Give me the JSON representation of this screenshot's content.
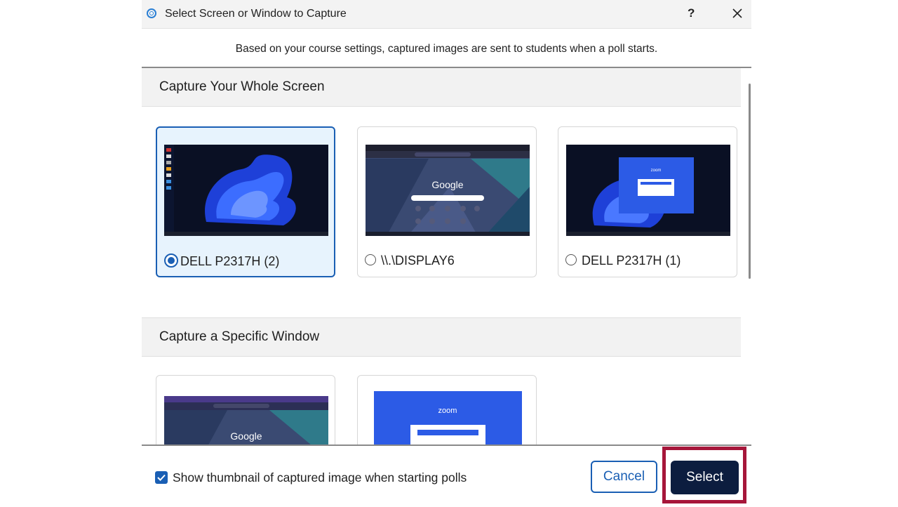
{
  "window": {
    "title": "Select Screen or Window to Capture",
    "help_label": "?"
  },
  "notice": "Based on your course settings, captured images are sent to students when a poll starts.",
  "sections": {
    "whole_screen": {
      "heading": "Capture Your Whole Screen",
      "tiles": [
        {
          "label": "DELL P2317H (2)",
          "selected": true
        },
        {
          "label": "\\\\.\\DISPLAY6",
          "selected": false
        },
        {
          "label": "DELL P2317H (1)",
          "selected": false
        }
      ]
    },
    "specific_window": {
      "heading": "Capture a Specific Window",
      "tiles": [
        {
          "label": "Google"
        },
        {
          "label": "zoom"
        }
      ]
    }
  },
  "thumbnails": {
    "google_logo": "Google",
    "zoom_logo": "zoom"
  },
  "footer": {
    "checkbox_label": "Show thumbnail of captured image when starting polls",
    "checkbox_checked": true,
    "cancel_label": "Cancel",
    "select_label": "Select"
  },
  "colors": {
    "accent": "#1a5fb4",
    "select_button": "#0c1d3f",
    "highlight": "#a6163a"
  }
}
